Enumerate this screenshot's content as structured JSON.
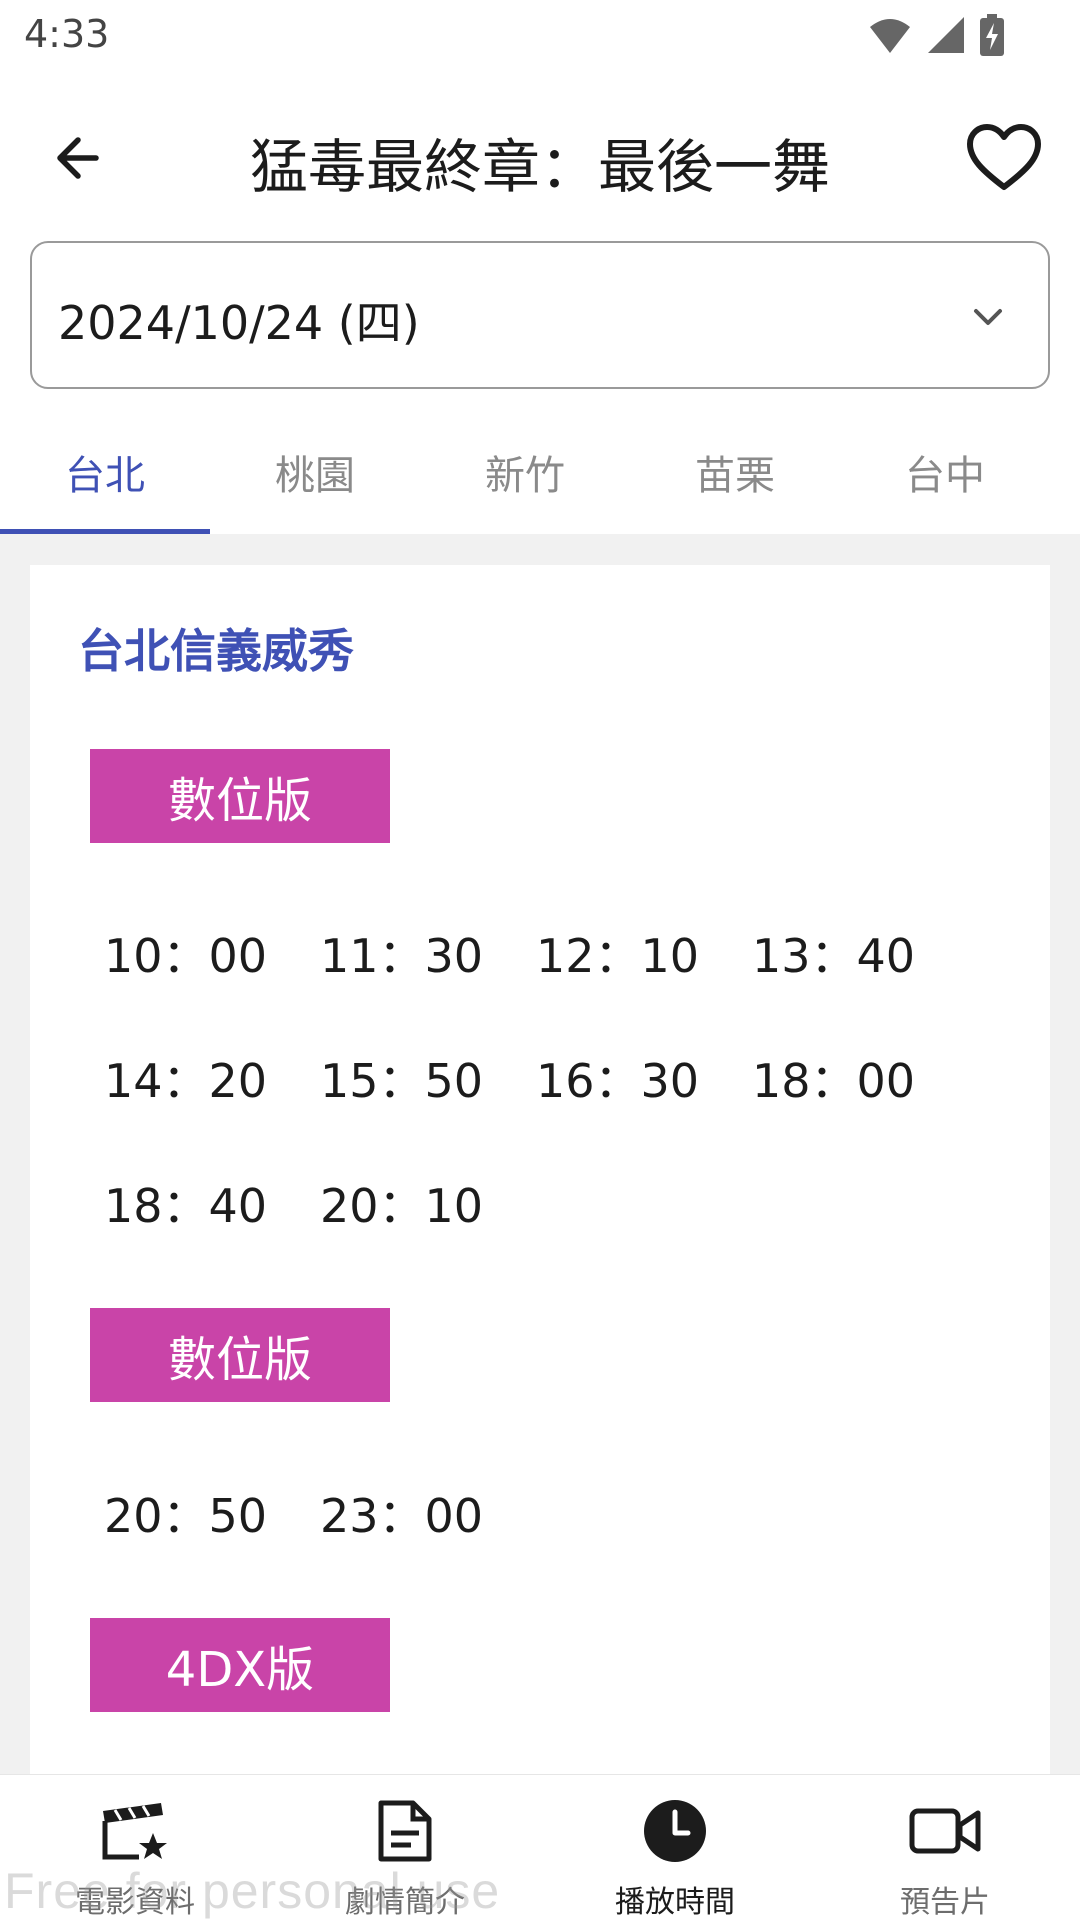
{
  "status_bar": {
    "time": "4:33",
    "icons": [
      "wifi-icon",
      "cell-signal-icon",
      "battery-charging-icon"
    ]
  },
  "app_bar": {
    "title": "猛毒最終章：最後一舞",
    "back_icon": "arrow-left-icon",
    "favorite_icon": "heart-outline-icon"
  },
  "date_select": {
    "value": "2024/10/24 (四)",
    "icon": "chevron-down-icon"
  },
  "tabs": [
    {
      "label": "台北",
      "active": true
    },
    {
      "label": "桃園",
      "active": false
    },
    {
      "label": "新竹",
      "active": false
    },
    {
      "label": "苗栗",
      "active": false
    },
    {
      "label": "台中",
      "active": false
    }
  ],
  "cinema": {
    "name": "台北信義威秀",
    "sections": [
      {
        "version": "數位版",
        "times": [
          "10：00",
          "11：30",
          "12：10",
          "13：40",
          "14：20",
          "15：50",
          "16：30",
          "18：00",
          "18：40",
          "20：10"
        ]
      },
      {
        "version": "數位版",
        "times": [
          "20：50",
          "23：00"
        ]
      },
      {
        "version": "4DX版",
        "times": []
      }
    ]
  },
  "bottom_nav": [
    {
      "label": "電影資料",
      "icon": "movie-clapper-star-icon",
      "active": false
    },
    {
      "label": "劇情簡介",
      "icon": "document-icon",
      "active": false
    },
    {
      "label": "播放時間",
      "icon": "clock-icon",
      "active": true
    },
    {
      "label": "預告片",
      "icon": "video-camera-icon",
      "active": false
    }
  ],
  "watermark": "Free for personal use",
  "colors": {
    "accent": "#3f51b5",
    "badge": "#c944a8",
    "content_bg": "#f1f1f1"
  }
}
